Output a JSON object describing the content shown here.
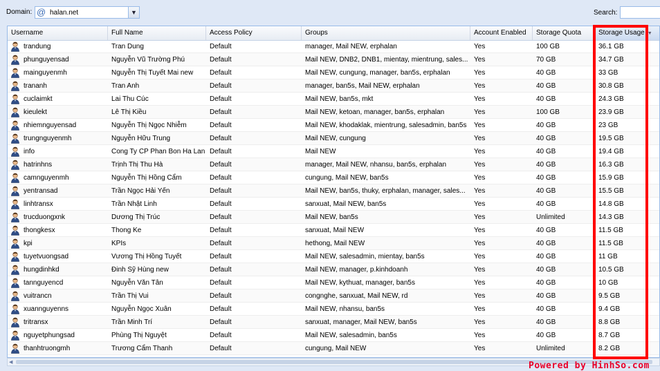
{
  "toolbar": {
    "domain_label": "Domain:",
    "domain_value": "halan.net",
    "search_label": "Search:",
    "search_value": ""
  },
  "columns": [
    {
      "key": "username",
      "label": "Username"
    },
    {
      "key": "fullname",
      "label": "Full Name"
    },
    {
      "key": "policy",
      "label": "Access Policy"
    },
    {
      "key": "groups",
      "label": "Groups"
    },
    {
      "key": "enabled",
      "label": "Account Enabled"
    },
    {
      "key": "quota",
      "label": "Storage Quota"
    },
    {
      "key": "usage",
      "label": "Storage Usage",
      "sorted": "desc"
    }
  ],
  "rows": [
    {
      "username": "trandung",
      "fullname": "Tran Dung",
      "policy": "Default",
      "groups": "manager, Mail NEW, erphalan",
      "enabled": "Yes",
      "quota": "100 GB",
      "usage": "36.1 GB"
    },
    {
      "username": "phunguyensad",
      "fullname": "Nguyễn Vũ Trường Phú",
      "policy": "Default",
      "groups": "Mail NEW, DNB2, DNB1, mientay, mientrung, sales...",
      "enabled": "Yes",
      "quota": "70 GB",
      "usage": "34.7 GB"
    },
    {
      "username": "mainguyenmh",
      "fullname": "Nguyễn Thị Tuyết Mai new",
      "policy": "Default",
      "groups": "Mail NEW, cungung, manager, ban5s, erphalan",
      "enabled": "Yes",
      "quota": "40 GB",
      "usage": "33 GB"
    },
    {
      "username": "trananh",
      "fullname": "Tran Anh",
      "policy": "Default",
      "groups": "manager, ban5s, Mail NEW, erphalan",
      "enabled": "Yes",
      "quota": "40 GB",
      "usage": "30.8 GB"
    },
    {
      "username": "cuclaimkt",
      "fullname": "Lai Thu Cúc",
      "policy": "Default",
      "groups": "Mail NEW, ban5s, mkt",
      "enabled": "Yes",
      "quota": "40 GB",
      "usage": "24.3 GB"
    },
    {
      "username": "kieulekt",
      "fullname": "Lê Thị Kiều",
      "policy": "Default",
      "groups": "Mail NEW, ketoan, manager, ban5s, erphalan",
      "enabled": "Yes",
      "quota": "100 GB",
      "usage": "23.9 GB"
    },
    {
      "username": "nhiemnguyensad",
      "fullname": "Nguyễn Thị Ngọc Nhiễm",
      "policy": "Default",
      "groups": "Mail NEW, khodaklak, mientrung, salesadmin, ban5s",
      "enabled": "Yes",
      "quota": "40 GB",
      "usage": "23 GB"
    },
    {
      "username": "trungnguyenmh",
      "fullname": "Nguyễn Hữu Trung",
      "policy": "Default",
      "groups": "Mail NEW, cungung",
      "enabled": "Yes",
      "quota": "40 GB",
      "usage": "19.5 GB"
    },
    {
      "username": "info",
      "fullname": "Cong Ty CP Phan Bon Ha Lan",
      "policy": "Default",
      "groups": "Mail NEW",
      "enabled": "Yes",
      "quota": "40 GB",
      "usage": "19.4 GB"
    },
    {
      "username": "hatrinhns",
      "fullname": "Trịnh Thị Thu Hà",
      "policy": "Default",
      "groups": "manager, Mail NEW, nhansu, ban5s, erphalan",
      "enabled": "Yes",
      "quota": "40 GB",
      "usage": "16.3 GB"
    },
    {
      "username": "camnguyenmh",
      "fullname": "Nguyễn Thị Hồng Cẩm",
      "policy": "Default",
      "groups": "cungung, Mail NEW, ban5s",
      "enabled": "Yes",
      "quota": "40 GB",
      "usage": "15.9 GB"
    },
    {
      "username": "yentransad",
      "fullname": "Trần Ngọc Hải Yến",
      "policy": "Default",
      "groups": "Mail NEW, ban5s, thuky, erphalan, manager, sales...",
      "enabled": "Yes",
      "quota": "40 GB",
      "usage": "15.5 GB"
    },
    {
      "username": "linhtransx",
      "fullname": "Trần Nhật Linh",
      "policy": "Default",
      "groups": "sanxuat, Mail NEW, ban5s",
      "enabled": "Yes",
      "quota": "40 GB",
      "usage": "14.8 GB"
    },
    {
      "username": "trucduongxnk",
      "fullname": "Dương Thị Trúc",
      "policy": "Default",
      "groups": "Mail NEW, ban5s",
      "enabled": "Yes",
      "quota": "Unlimited",
      "usage": "14.3 GB"
    },
    {
      "username": "thongkesx",
      "fullname": "Thong Ke",
      "policy": "Default",
      "groups": "sanxuat, Mail NEW",
      "enabled": "Yes",
      "quota": "40 GB",
      "usage": "11.5 GB"
    },
    {
      "username": "kpi",
      "fullname": "KPIs",
      "policy": "Default",
      "groups": "hethong, Mail NEW",
      "enabled": "Yes",
      "quota": "40 GB",
      "usage": "11.5 GB"
    },
    {
      "username": "tuyetvuongsad",
      "fullname": "Vương Thị Hồng Tuyết",
      "policy": "Default",
      "groups": "Mail NEW, salesadmin, mientay, ban5s",
      "enabled": "Yes",
      "quota": "40 GB",
      "usage": "11 GB"
    },
    {
      "username": "hungdinhkd",
      "fullname": "Đinh Sỹ Hùng new",
      "policy": "Default",
      "groups": "Mail NEW, manager, p.kinhdoanh",
      "enabled": "Yes",
      "quota": "40 GB",
      "usage": "10.5 GB"
    },
    {
      "username": "tannguyencd",
      "fullname": "Nguyễn Văn Tân",
      "policy": "Default",
      "groups": "Mail NEW, kythuat, manager, ban5s",
      "enabled": "Yes",
      "quota": "40 GB",
      "usage": "10 GB"
    },
    {
      "username": "vuitrancn",
      "fullname": "Trần Thị Vui",
      "policy": "Default",
      "groups": "congnghe, sanxuat, Mail NEW, rd",
      "enabled": "Yes",
      "quota": "40 GB",
      "usage": "9.5 GB"
    },
    {
      "username": "xuannguyenns",
      "fullname": "Nguyễn Ngọc Xuân",
      "policy": "Default",
      "groups": "Mail NEW, nhansu, ban5s",
      "enabled": "Yes",
      "quota": "40 GB",
      "usage": "9.4 GB"
    },
    {
      "username": "tritransx",
      "fullname": "Trần Minh Trí",
      "policy": "Default",
      "groups": "sanxuat, manager, Mail NEW, ban5s",
      "enabled": "Yes",
      "quota": "40 GB",
      "usage": "8.8 GB"
    },
    {
      "username": "nguyetphungsad",
      "fullname": "Phùng Thị Nguyệt",
      "policy": "Default",
      "groups": "Mail NEW, salesadmin, ban5s",
      "enabled": "Yes",
      "quota": "40 GB",
      "usage": "8.7 GB"
    },
    {
      "username": "thanhtruongmh",
      "fullname": "Trương Cẩm Thanh",
      "policy": "Default",
      "groups": "cungung, Mail NEW",
      "enabled": "Yes",
      "quota": "Unlimited",
      "usage": "8.2 GB"
    }
  ],
  "watermark": "Powered by HinhSo.com",
  "colors": {
    "highlight": "#ff0000",
    "watermark": "#e8002a",
    "header_border": "#99bbe8"
  }
}
